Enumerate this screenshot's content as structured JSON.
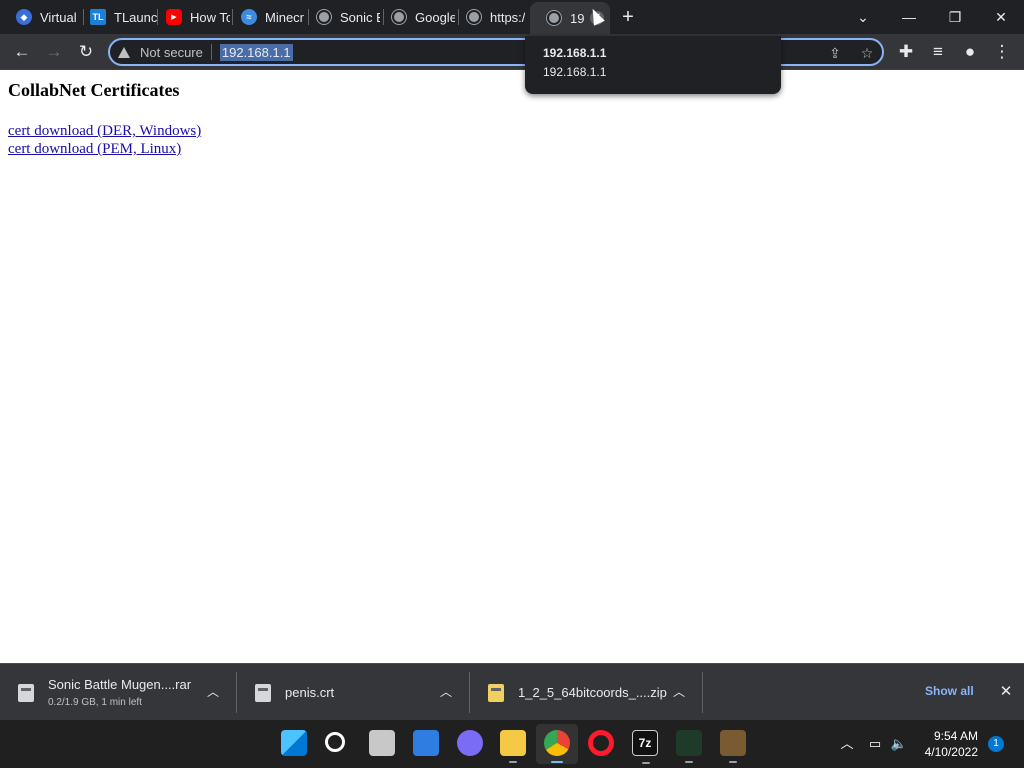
{
  "tabs": [
    {
      "title": "Virtual",
      "icon": "virtual-box-icon",
      "color": "#3b6fd8",
      "glyph": ""
    },
    {
      "title": "TLaunc",
      "icon": "tlauncher-icon",
      "color": "#1e7fd6",
      "glyph": "TL"
    },
    {
      "title": "How To",
      "icon": "youtube-icon",
      "color": "#ff0000",
      "glyph": "▶"
    },
    {
      "title": "Minecr",
      "icon": "minecraft-icon",
      "color": "#3d8be0",
      "glyph": ""
    },
    {
      "title": "Sonic B",
      "icon": "globe-icon",
      "color": "#9aa0a6",
      "glyph": ""
    },
    {
      "title": "Google",
      "icon": "globe-icon",
      "color": "#9aa0a6",
      "glyph": ""
    },
    {
      "title": "https:/",
      "icon": "globe-icon",
      "color": "#9aa0a6",
      "glyph": ""
    },
    {
      "title": "19",
      "icon": "globe-icon",
      "color": "#9aa0a6",
      "glyph": ""
    }
  ],
  "toolbar": {
    "security_label": "Not secure",
    "url": "192.168.1.1"
  },
  "tooltip": {
    "title": "192.168.1.1",
    "url": "192.168.1.1"
  },
  "page": {
    "heading": "CollabNet Certificates",
    "links": [
      {
        "label": "cert download (DER, Windows)"
      },
      {
        "label": "cert download (PEM, Linux)"
      }
    ]
  },
  "downloads": {
    "items": [
      {
        "name": "Sonic Battle Mugen....rar",
        "status": "0.2/1.9 GB, 1 min left"
      },
      {
        "name": "penis.crt",
        "status": ""
      },
      {
        "name": "1_2_5_64bitcoords_....zip",
        "status": ""
      }
    ],
    "show_all": "Show all"
  },
  "taskbar": {
    "time": "9:54 AM",
    "date": "4/10/2022",
    "notification_count": "1"
  },
  "colors": {
    "accent": "#8ab4f8",
    "link": "#1a0dab",
    "tab_strip": "#202124",
    "toolbar": "#35363a"
  }
}
